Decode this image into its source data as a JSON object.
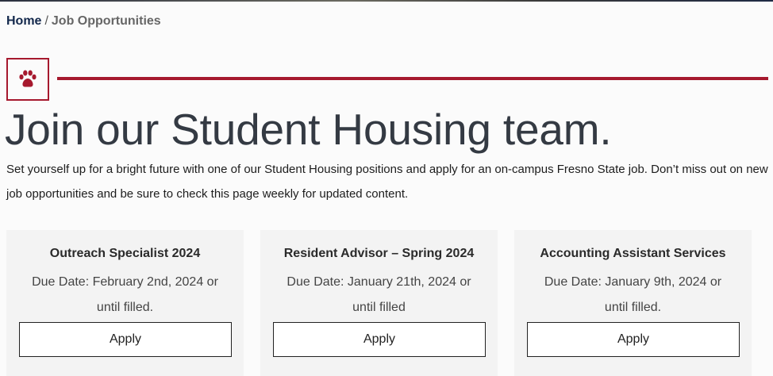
{
  "breadcrumb": {
    "home": "Home",
    "separator": "/",
    "current": "Job Opportunities"
  },
  "badge": {
    "icon": "paw-icon"
  },
  "heading": "Join our Student Housing team.",
  "intro": "Set yourself up for a bright future with one of our Student Housing positions and apply for an on-campus Fresno State job. Don’t miss out on new job opportunities and be sure to check this page weekly for updated content.",
  "jobs": [
    {
      "title": "Outreach Specialist 2024",
      "due": "Due Date: February 2nd, 2024 or until filled.",
      "apply_label": "Apply"
    },
    {
      "title": "Resident Advisor – Spring 2024",
      "due": "Due Date: January 21th, 2024 or until filled",
      "apply_label": "Apply"
    },
    {
      "title": "Accounting Assistant Services",
      "due": "Due Date: January 9th, 2024 or until filled.",
      "apply_label": "Apply"
    }
  ],
  "colors": {
    "accent": "#a6192e",
    "breadcrumb_link": "#13284c",
    "heading": "#343a43",
    "card_bg": "#f3f3f3"
  }
}
